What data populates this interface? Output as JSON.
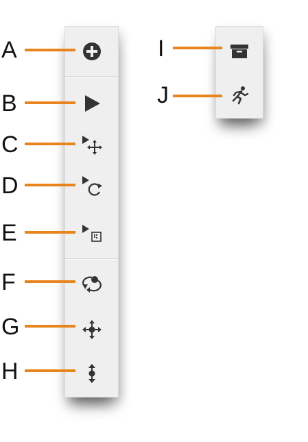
{
  "accent_color": "#e8841c",
  "icon_color": "#333333",
  "toolbar_main": {
    "tools": [
      {
        "letter": "A",
        "icon": "add-circle-icon"
      },
      {
        "letter": "B",
        "icon": "select-arrow-icon"
      },
      {
        "letter": "C",
        "icon": "select-move-icon"
      },
      {
        "letter": "D",
        "icon": "select-rotate-icon"
      },
      {
        "letter": "E",
        "icon": "select-scale-icon"
      },
      {
        "letter": "F",
        "icon": "orbit-icon"
      },
      {
        "letter": "G",
        "icon": "pan-move-icon"
      },
      {
        "letter": "H",
        "icon": "dolly-vertical-icon"
      }
    ]
  },
  "toolbar_secondary": {
    "tools": [
      {
        "letter": "I",
        "icon": "archive-box-icon"
      },
      {
        "letter": "J",
        "icon": "running-figure-icon"
      }
    ]
  }
}
